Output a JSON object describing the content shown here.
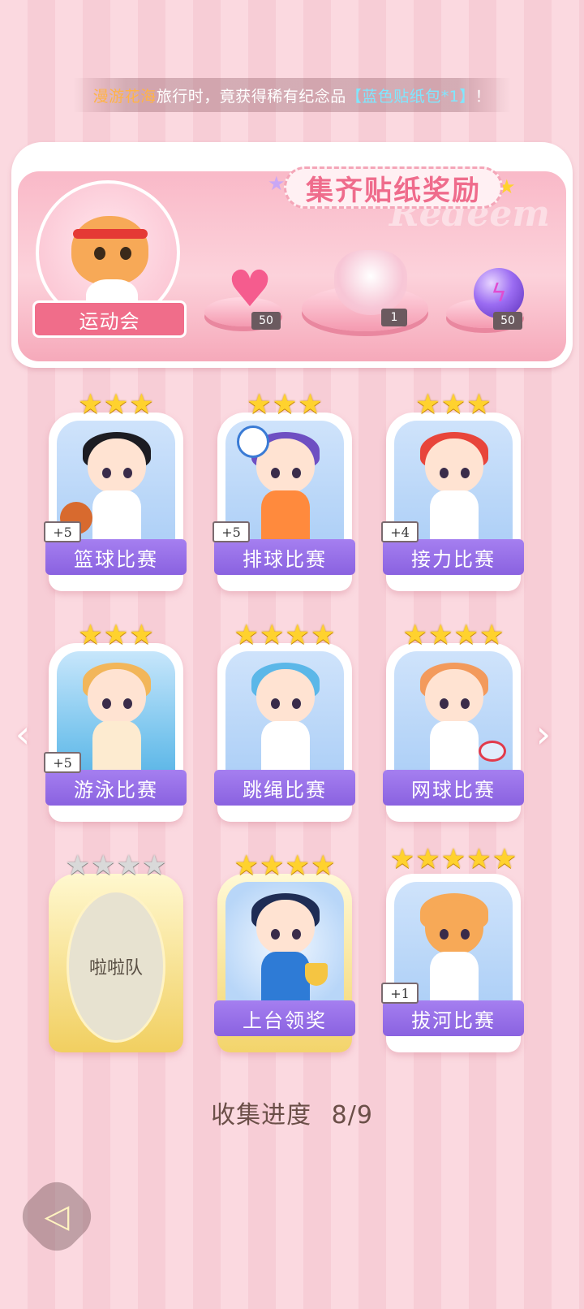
{
  "toast": {
    "part1": "漫游花海",
    "part2": "旅行时，竟获得稀有纪念品",
    "part3": "【蓝色贴纸包*1】",
    "part4": "！"
  },
  "banner": {
    "title": "集齐贴纸奖励",
    "ghost_text": "Redeem",
    "theme_label": "运动会",
    "rewards": [
      {
        "icon": "heart-gem-icon",
        "count": "50"
      },
      {
        "icon": "ribbon-icon",
        "count": "1"
      },
      {
        "icon": "lightning-orb-icon",
        "count": "50"
      }
    ]
  },
  "cards": [
    {
      "label": "篮球比赛",
      "stars": 3,
      "filled": 3,
      "plus": "+5",
      "state": "normal"
    },
    {
      "label": "排球比赛",
      "stars": 3,
      "filled": 3,
      "plus": "+5",
      "state": "normal"
    },
    {
      "label": "接力比赛",
      "stars": 3,
      "filled": 3,
      "plus": "+4",
      "state": "normal"
    },
    {
      "label": "游泳比赛",
      "stars": 3,
      "filled": 3,
      "plus": "+5",
      "state": "normal"
    },
    {
      "label": "跳绳比赛",
      "stars": 4,
      "filled": 4,
      "plus": "",
      "state": "normal"
    },
    {
      "label": "网球比赛",
      "stars": 4,
      "filled": 4,
      "plus": "",
      "state": "normal"
    },
    {
      "label": "啦啦队",
      "stars": 4,
      "filled": 0,
      "plus": "",
      "state": "locked"
    },
    {
      "label": "上台领奖",
      "stars": 4,
      "filled": 4,
      "plus": "",
      "state": "gold"
    },
    {
      "label": "拔河比赛",
      "stars": 5,
      "filled": 5,
      "plus": "+1",
      "state": "normal"
    }
  ],
  "progress": {
    "label": "收集进度",
    "value": "8/9"
  },
  "colors": {
    "accent_pink": "#f06d8a",
    "label_purple": "#8a62e0",
    "star_gold": "#ffd22e"
  }
}
